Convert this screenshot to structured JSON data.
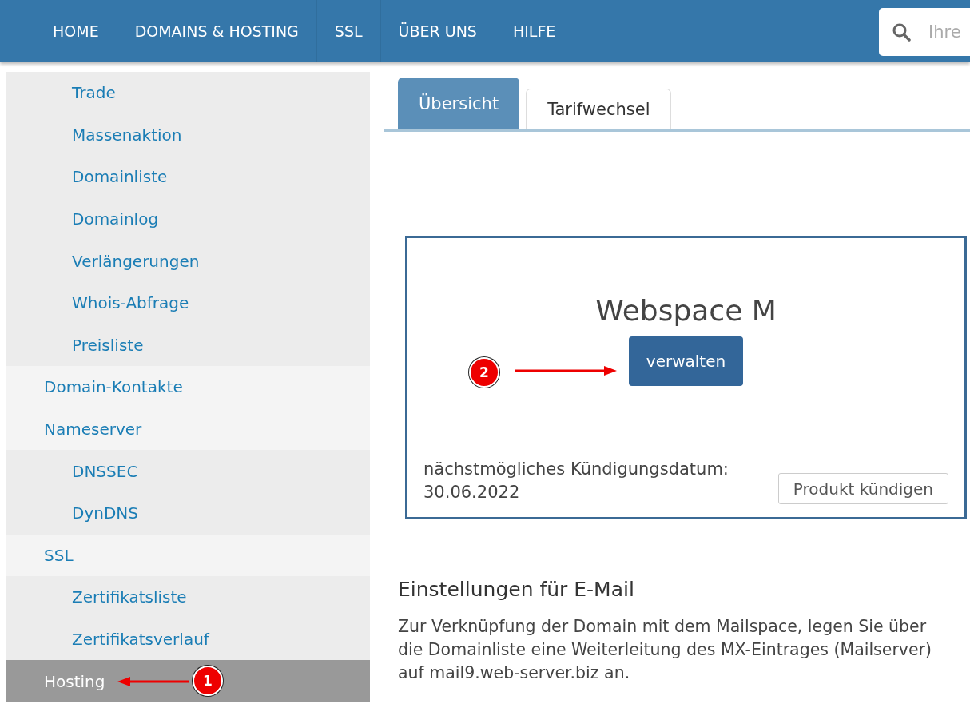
{
  "nav": {
    "items": [
      {
        "label": "HOME"
      },
      {
        "label": "DOMAINS & HOSTING"
      },
      {
        "label": "SSL"
      },
      {
        "label": "ÜBER UNS"
      },
      {
        "label": "HILFE"
      }
    ],
    "search": {
      "placeholder": "Ihre"
    }
  },
  "sidebar": {
    "continued_children": [
      {
        "label": "Trade",
        "selected": false
      },
      {
        "label": "Massenaktion",
        "selected": false
      },
      {
        "label": "Domainliste",
        "selected": false
      },
      {
        "label": "Domainlog",
        "selected": false
      },
      {
        "label": "Verlängerungen",
        "selected": false
      },
      {
        "label": "Whois-Abfrage",
        "selected": false
      },
      {
        "label": "Preisliste",
        "selected": false
      }
    ],
    "items": [
      {
        "label": "Domain-Kontakte",
        "selected": false
      },
      {
        "label": "Nameserver",
        "selected": false,
        "children": [
          {
            "label": "DNSSEC",
            "selected": false
          },
          {
            "label": "DynDNS",
            "selected": false
          }
        ]
      },
      {
        "label": "SSL",
        "selected": false,
        "children": [
          {
            "label": "Zertifikatsliste",
            "selected": false
          },
          {
            "label": "Zertifikatsverlauf",
            "selected": false
          }
        ]
      },
      {
        "label": "Hosting",
        "selected": true,
        "annotation": "1"
      }
    ]
  },
  "tabs": [
    {
      "label": "Übersicht",
      "selected": true
    },
    {
      "label": "Tarifwechsel",
      "selected": false
    }
  ],
  "product": {
    "title": "Webspace M",
    "manage_button": "verwalten",
    "annotation": "2",
    "cancel_date_label": "nächstmögliches Kündigungsdatum:",
    "cancel_date": "30.06.2022",
    "cancel_button": "Produkt kündigen"
  },
  "email": {
    "heading": "Einstellungen für E-Mail",
    "text": "Zur Verknüpfung der Domain mit dem Mailspace, legen Sie über die Domainliste eine Weiterleitung des MX-Eintrages (Mailserver) auf mail9.web-server.biz an."
  }
}
